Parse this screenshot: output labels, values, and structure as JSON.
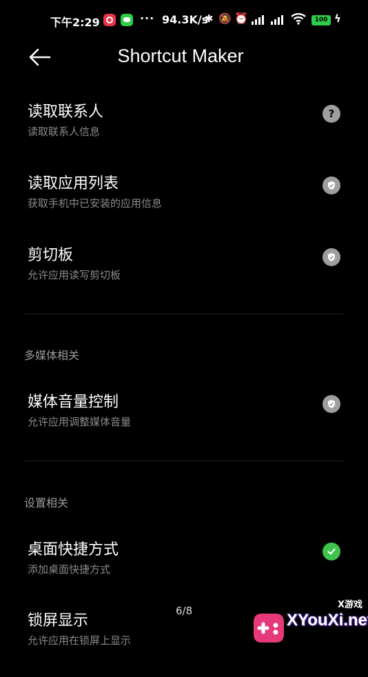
{
  "status_bar": {
    "time": "下午2:29",
    "more": "···",
    "net_speed": "94.3K/s",
    "battery": "100",
    "icons": [
      "netease-music-icon",
      "wechat-icon",
      "bluetooth-icon",
      "mute-icon",
      "alarm-icon",
      "signal-icon",
      "signal-icon",
      "wifi-icon",
      "battery-icon",
      "charging-icon"
    ]
  },
  "header": {
    "title": "Shortcut Maker",
    "back_icon": "back-arrow-icon"
  },
  "permissions": [
    {
      "title": "读取联系人",
      "desc": "读取联系人信息",
      "status": "question",
      "icon": "question-icon"
    },
    {
      "title": "读取应用列表",
      "desc": "获取手机中已安装的应用信息",
      "status": "granted-grey",
      "icon": "check-icon"
    },
    {
      "title": "剪切板",
      "desc": "允许应用读写剪切板",
      "status": "granted-grey",
      "icon": "check-icon"
    }
  ],
  "sections": [
    {
      "header": "多媒体相关",
      "items": [
        {
          "title": "媒体音量控制",
          "desc": "允许应用调整媒体音量",
          "status": "granted-grey",
          "icon": "check-icon"
        }
      ]
    },
    {
      "header": "设置相关",
      "items": [
        {
          "title": "桌面快捷方式",
          "desc": "添加桌面快捷方式",
          "status": "granted-green",
          "icon": "check-icon"
        },
        {
          "title": "锁屏显示",
          "desc": "允许应用在锁屏上显示",
          "status": "denied-red",
          "icon": "close-icon"
        }
      ]
    }
  ],
  "pager": {
    "indicator": "6/8"
  },
  "watermark": {
    "brand": "XYouXi.net",
    "tag": "X游戏",
    "icon": "gamepad-logo-icon"
  },
  "colors": {
    "background": "#000000",
    "green": "#3ec44c",
    "grey": "#9e9e9e",
    "subtitle": "#8a8a8a"
  }
}
